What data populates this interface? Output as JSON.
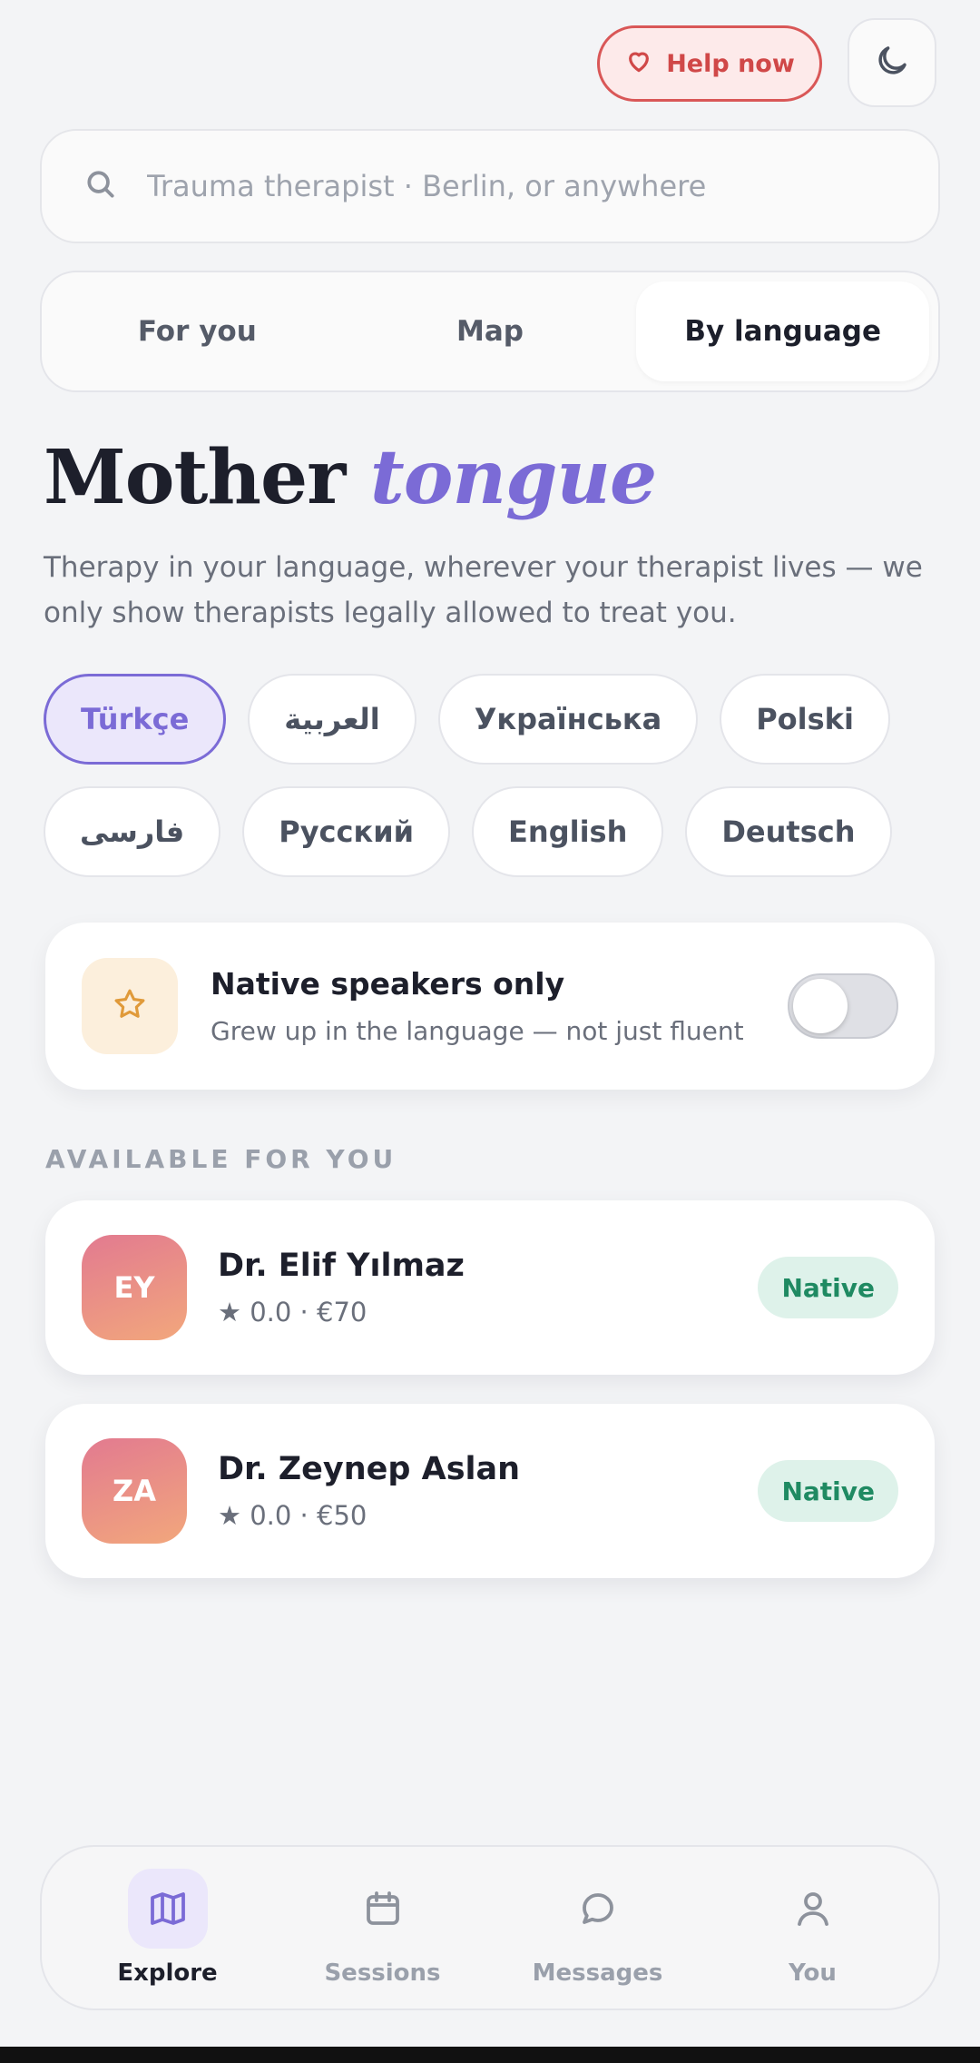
{
  "header": {
    "help_label": "Help now"
  },
  "search": {
    "placeholder": "Trauma therapist · Berlin, or anywhere"
  },
  "tabs": [
    {
      "label": "For you"
    },
    {
      "label": "Map"
    },
    {
      "label": "By language"
    }
  ],
  "active_tab": "By language",
  "heading": {
    "main": "Mother",
    "accent": "tongue"
  },
  "subtitle": "Therapy in your language, wherever your therapist lives — we only show therapists legally allowed to treat you.",
  "languages": [
    {
      "label": "Türkçe"
    },
    {
      "label": "العربية"
    },
    {
      "label": "Українська"
    },
    {
      "label": "Polski"
    },
    {
      "label": "فارسی"
    },
    {
      "label": "Русский"
    },
    {
      "label": "English"
    },
    {
      "label": "Deutsch"
    }
  ],
  "selected_language": "Türkçe",
  "native_filter": {
    "title": "Native speakers only",
    "subtitle": "Grew up in the language — not just fluent",
    "enabled": false
  },
  "section_label": "AVAILABLE FOR YOU",
  "therapists": [
    {
      "initials": "EY",
      "name": "Dr. Elif Yılmaz",
      "meta": "★ 0.0 · €70",
      "badge": "Native"
    },
    {
      "initials": "ZA",
      "name": "Dr. Zeynep Aslan",
      "meta": "★ 0.0 · €50",
      "badge": "Native"
    }
  ],
  "nav": [
    {
      "label": "Explore",
      "icon": "map-icon"
    },
    {
      "label": "Sessions",
      "icon": "calendar-icon"
    },
    {
      "label": "Messages",
      "icon": "chat-bubble-icon"
    },
    {
      "label": "You",
      "icon": "user-icon"
    }
  ],
  "active_nav": "Explore",
  "colors": {
    "accent": "#7b6bd6",
    "help": "#d95757",
    "native_badge": "#1f8a62",
    "background": "#f3f4f6"
  }
}
